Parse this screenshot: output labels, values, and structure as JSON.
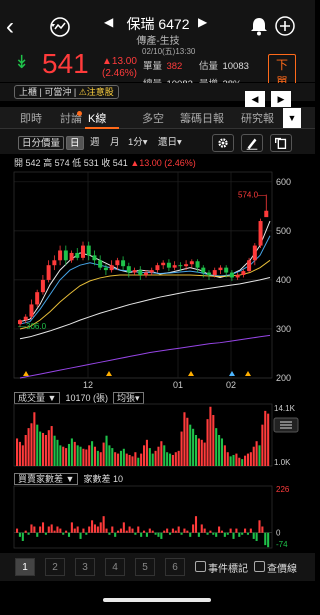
{
  "header": {
    "back_icon": "back-arrow-icon",
    "title": "保瑞 6472",
    "subtitle": "傳產-生技",
    "prev_arrow": "◀",
    "next_arrow": "▶"
  },
  "quote": {
    "price": "541",
    "change": "▲13.00",
    "change_pct": "(2.46%)",
    "timestamp": "02/10(五)13:30",
    "single_vol_label": "單量",
    "single_vol": "382",
    "total_vol_label": "總量",
    "total_vol": "10083",
    "est_vol_label": "估量",
    "est_vol": "10083",
    "vol_growth_label": "量增",
    "vol_growth": "28%",
    "order_label": "下單"
  },
  "status": {
    "badges": [
      "上櫃",
      "可當沖",
      "⚠注意股"
    ]
  },
  "tabs": [
    "即時",
    "討論",
    "K線",
    "多空",
    "籌碼日報",
    "研究報"
  ],
  "active_tab": "K線",
  "toolbar": {
    "indicator": "日分價量",
    "period_day": "日",
    "period_week": "週",
    "period_month": "月",
    "minute": "1分",
    "adjust": "還日"
  },
  "ohlc": {
    "open_label": "開",
    "open": "542",
    "high_label": "高",
    "high": "574",
    "low_label": "低",
    "low": "531",
    "close_label": "收",
    "close": "541",
    "change": "▲13.00 (2.46%)"
  },
  "chart_data": [
    {
      "type": "candlestick",
      "name": "price",
      "y_ticks": [
        600,
        500,
        400,
        300,
        200
      ],
      "ylim": [
        200,
        620
      ],
      "x_ticks": [
        "12",
        "01",
        "02"
      ],
      "annotations": [
        {
          "label": "574.0",
          "value": 574
        },
        {
          "label": "306.0",
          "value": 306
        }
      ],
      "moving_averages": [
        {
          "color": "#ffffff",
          "values": [
            315,
            320,
            350,
            390,
            420,
            440,
            455,
            450,
            440,
            430,
            420,
            415,
            420,
            418,
            412,
            415,
            420,
            425,
            420,
            410,
            405,
            410,
            420,
            440,
            470,
            520
          ]
        },
        {
          "color": "#4db6ff",
          "values": [
            310,
            315,
            340,
            370,
            400,
            420,
            430,
            435,
            430,
            425,
            420,
            418,
            415,
            415,
            413,
            414,
            416,
            418,
            415,
            410,
            408,
            410,
            418,
            430,
            450,
            490
          ]
        },
        {
          "color": "#ffd23f",
          "values": [
            300,
            305,
            318,
            335,
            355,
            372,
            388,
            398,
            404,
            408,
            410,
            410,
            410,
            410,
            410,
            410,
            410,
            410,
            409,
            408,
            407,
            408,
            410,
            415,
            425,
            440
          ]
        },
        {
          "color": "#ffffff",
          "values": [
            280,
            284,
            290,
            296,
            303,
            310,
            318,
            325,
            332,
            338,
            344,
            350,
            355,
            360,
            365,
            369,
            373,
            377,
            380,
            383,
            386,
            389,
            392,
            396,
            400,
            405
          ]
        },
        {
          "color": "#a64dff",
          "values": [
            200,
            204,
            208,
            212,
            216,
            220,
            224,
            228,
            232,
            236,
            240,
            244,
            248,
            252,
            255,
            258,
            261,
            264,
            267,
            270,
            272,
            275,
            278,
            281,
            284,
            287
          ]
        }
      ],
      "candles": [
        [
          310,
          318,
          305,
          320
        ],
        [
          318,
          325,
          312,
          330
        ],
        [
          325,
          350,
          320,
          360
        ],
        [
          350,
          375,
          345,
          380
        ],
        [
          375,
          400,
          370,
          410
        ],
        [
          400,
          430,
          395,
          440
        ],
        [
          430,
          440,
          420,
          450
        ],
        [
          440,
          460,
          430,
          470
        ],
        [
          460,
          440,
          430,
          470
        ],
        [
          440,
          455,
          435,
          460
        ],
        [
          455,
          445,
          440,
          465
        ],
        [
          445,
          470,
          440,
          478
        ],
        [
          470,
          450,
          440,
          478
        ],
        [
          450,
          440,
          430,
          460
        ],
        [
          440,
          425,
          420,
          450
        ],
        [
          425,
          420,
          410,
          432
        ],
        [
          420,
          430,
          415,
          440
        ],
        [
          430,
          440,
          420,
          445
        ],
        [
          440,
          428,
          420,
          448
        ],
        [
          428,
          415,
          405,
          435
        ],
        [
          415,
          420,
          410,
          425
        ],
        [
          420,
          410,
          400,
          428
        ],
        [
          410,
          415,
          405,
          420
        ],
        [
          415,
          420,
          410,
          425
        ],
        [
          420,
          430,
          415,
          435
        ],
        [
          430,
          435,
          422,
          440
        ],
        [
          435,
          425,
          418,
          442
        ],
        [
          425,
          430,
          420,
          438
        ],
        [
          430,
          428,
          418,
          436
        ],
        [
          428,
          432,
          420,
          440
        ],
        [
          432,
          438,
          425,
          442
        ],
        [
          438,
          425,
          415,
          442
        ],
        [
          425,
          415,
          405,
          430
        ],
        [
          415,
          410,
          400,
          420
        ],
        [
          410,
          420,
          405,
          425
        ],
        [
          420,
          425,
          412,
          430
        ],
        [
          425,
          415,
          405,
          430
        ],
        [
          415,
          405,
          398,
          420
        ],
        [
          405,
          410,
          400,
          415
        ],
        [
          410,
          418,
          405,
          422
        ],
        [
          418,
          440,
          415,
          445
        ],
        [
          440,
          470,
          430,
          475
        ],
        [
          470,
          520,
          465,
          525
        ],
        [
          528,
          541,
          531,
          574
        ]
      ]
    },
    {
      "type": "bar",
      "name": "volume",
      "y_ticks": [
        "14.1K",
        "1.0K"
      ],
      "values": [
        40,
        35,
        30,
        45,
        55,
        62,
        78,
        60,
        50,
        48,
        45,
        52,
        58,
        44,
        38,
        30,
        28,
        26,
        32,
        40,
        35,
        30,
        28,
        25,
        24,
        30,
        36,
        28,
        22,
        20,
        34,
        44,
        30,
        26,
        20,
        18,
        22,
        25,
        18,
        16,
        14,
        20,
        12,
        18,
        30,
        38,
        26,
        18,
        22,
        28,
        36,
        30,
        20,
        18,
        16,
        20,
        22,
        50,
        78,
        70,
        60,
        54,
        45,
        40,
        38,
        34,
        68,
        86,
        74,
        55,
        45,
        40,
        30,
        20,
        14,
        16,
        18,
        12,
        10,
        15,
        18,
        20,
        28,
        36,
        30,
        60,
        80,
        76
      ],
      "up": [
        1,
        1,
        1,
        1,
        1,
        1,
        1,
        0,
        0,
        1,
        1,
        1,
        1,
        0,
        0,
        0,
        1,
        1,
        0,
        0,
        1,
        0,
        0,
        1,
        1,
        1,
        0,
        1,
        0,
        1,
        1,
        0,
        0,
        0,
        1,
        1,
        0,
        0,
        1,
        1,
        1,
        1,
        0,
        1,
        1,
        1,
        0,
        0,
        1,
        1,
        1,
        0,
        0,
        0,
        1,
        1,
        1,
        1,
        1,
        1,
        0,
        0,
        0,
        1,
        1,
        1,
        1,
        1,
        1,
        0,
        0,
        0,
        1,
        1,
        0,
        0,
        1,
        1,
        0,
        1,
        1,
        1,
        1,
        1,
        0,
        1,
        1,
        1
      ]
    },
    {
      "type": "bar",
      "name": "institutional",
      "y_ticks": [
        "226",
        "0",
        "-74"
      ],
      "ylim": [
        -74,
        226
      ],
      "values": [
        20,
        -20,
        -40,
        10,
        -10,
        40,
        30,
        -20,
        30,
        50,
        -10,
        30,
        40,
        10,
        30,
        20,
        -10,
        10,
        -20,
        50,
        20,
        30,
        -30,
        20,
        -10,
        30,
        60,
        40,
        30,
        50,
        80,
        20,
        -10,
        30,
        -20,
        10,
        20,
        50,
        10,
        30,
        20,
        -10,
        30,
        -20,
        10,
        -20,
        20,
        10,
        -10,
        -20,
        -30,
        10,
        20,
        -10,
        20,
        10,
        30,
        -10,
        20,
        10,
        -20,
        40,
        80,
        -20,
        40,
        20,
        -10,
        10,
        -10,
        -20,
        30,
        10,
        -20,
        -10,
        20,
        -30,
        20,
        -20,
        -10,
        20,
        -10,
        20,
        -30,
        -40,
        60,
        30,
        -60,
        -70
      ]
    }
  ],
  "volume_panel": {
    "selector": "成交量",
    "summary": "10170 (張)",
    "mode": "均張"
  },
  "inst_panel": {
    "selector": "買賣家數差",
    "summary": "家數差 10"
  },
  "pages": [
    "1",
    "2",
    "3",
    "4",
    "5",
    "6"
  ],
  "active_page": "1",
  "checkboxes": {
    "event_label": "事件標記",
    "line_label": "查價線"
  }
}
